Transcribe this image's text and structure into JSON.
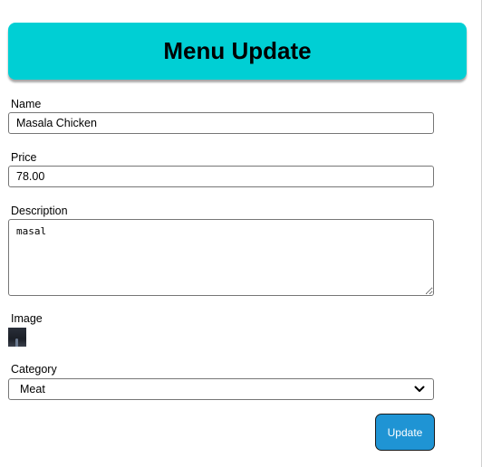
{
  "header": {
    "title": "Menu Update"
  },
  "form": {
    "name": {
      "label": "Name",
      "value": "Masala Chicken"
    },
    "price": {
      "label": "Price",
      "value": "78.00"
    },
    "description": {
      "label": "Description",
      "value": "masal"
    },
    "image": {
      "label": "Image"
    },
    "category": {
      "label": "Category",
      "selected": "Meat"
    },
    "submit_label": "Update"
  },
  "colors": {
    "header_bg": "#00cfd4",
    "button_bg": "#1f94d4"
  },
  "icons": {
    "select_chevron": "chevron-down-icon"
  }
}
